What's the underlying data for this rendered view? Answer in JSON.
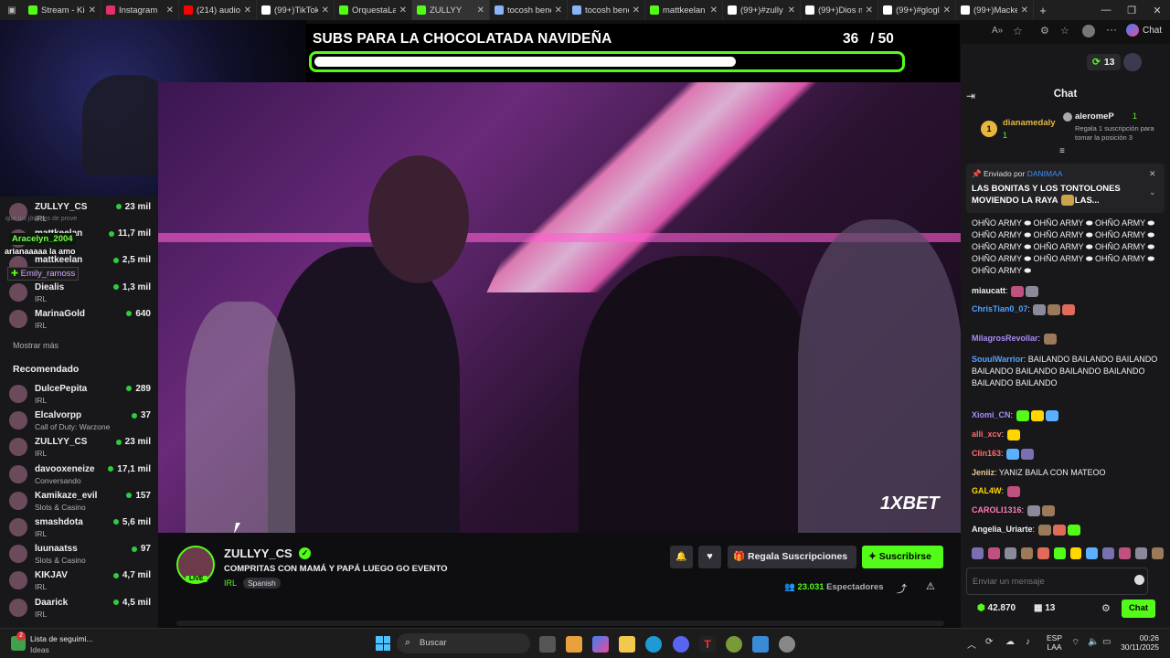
{
  "browser": {
    "tabs": [
      {
        "label": "Stream - Kic",
        "icon": "kick-icon",
        "color": "#53fc18"
      },
      {
        "label": "Instagram",
        "icon": "instagram-icon",
        "color": "#e1306c"
      },
      {
        "label": "(214) audio",
        "icon": "youtube-icon",
        "color": "#ff0000"
      },
      {
        "label": "(99+)TikTok",
        "icon": "tiktok-icon",
        "color": "#ffffff"
      },
      {
        "label": "OrquestaLal",
        "icon": "kick-icon",
        "color": "#53fc18"
      },
      {
        "label": "ZULLYY",
        "icon": "kick-icon",
        "color": "#53fc18"
      },
      {
        "label": "tocosh bene",
        "icon": "search-icon",
        "color": "#8ab4f8"
      },
      {
        "label": "tocosh bene",
        "icon": "search-icon",
        "color": "#8ab4f8"
      },
      {
        "label": "mattkeelan",
        "icon": "kick-icon",
        "color": "#53fc18"
      },
      {
        "label": "(99+)#zully",
        "icon": "tiktok-icon",
        "color": "#ffffff"
      },
      {
        "label": "(99+)Dios m",
        "icon": "tiktok-icon",
        "color": "#ffffff"
      },
      {
        "label": "(99+)#glogl",
        "icon": "tiktok-icon",
        "color": "#ffffff"
      },
      {
        "label": "(99+)Macke",
        "icon": "tiktok-icon",
        "color": "#ffffff"
      }
    ],
    "chat_button": "Chat"
  },
  "overlay": {
    "goal_title": "SUBS PARA LA CHOCOLATADA NAVIDEÑA",
    "goal_current": "36",
    "goal_total": "/ 50",
    "goal_progress": 0.72,
    "sponsor": "1XBET"
  },
  "viewer_overlay": {
    "names": [
      "Aracelyn_2004",
      "arianaaaaa la amo",
      "Emily_ramoss"
    ],
    "ghost_text": "que tus jóvenes de prove"
  },
  "sidebar": {
    "following": [
      {
        "name": "ZULLYY_CS",
        "category": "IRL",
        "viewers": "23 mil"
      },
      {
        "name": "mattkeelan",
        "category": "",
        "viewers": "11,7 mil"
      },
      {
        "name": "mattkeelan",
        "category": "",
        "viewers": "2,5 mil"
      },
      {
        "name": "Diealis",
        "category": "IRL",
        "viewers": "1,3 mil"
      },
      {
        "name": "MarinaGold",
        "category": "IRL",
        "viewers": "640"
      }
    ],
    "show_more": "Mostrar más",
    "recommended_title": "Recomendado",
    "recommended": [
      {
        "name": "DulcePepita",
        "category": "IRL",
        "viewers": "289"
      },
      {
        "name": "Elcalvorpp",
        "category": "Call of Duty: Warzone",
        "viewers": "37"
      },
      {
        "name": "ZULLYY_CS",
        "category": "IRL",
        "viewers": "23 mil"
      },
      {
        "name": "davooxeneize",
        "category": "Conversando",
        "viewers": "17,1 mil"
      },
      {
        "name": "Kamikaze_evil",
        "category": "Slots & Casino",
        "viewers": "157"
      },
      {
        "name": "smashdota",
        "category": "IRL",
        "viewers": "5,6 mil"
      },
      {
        "name": "luunaatss",
        "category": "Slots & Casino",
        "viewers": "97"
      },
      {
        "name": "KIKJAV",
        "category": "IRL",
        "viewers": "4,7 mil"
      },
      {
        "name": "Daarick",
        "category": "IRL",
        "viewers": "4,5 mil"
      }
    ]
  },
  "stream": {
    "name": "ZULLYY_CS",
    "title": "COMPRITAS CON MAMÁ Y PAPÁ LUEGO GO EVENTO",
    "category": "IRL",
    "tag": "Spanish",
    "live": "LIVE",
    "viewers": "23.031",
    "viewers_label": "Espectadores",
    "gift_button": "Regala Suscripciones",
    "subscribe_button": "Suscribirse"
  },
  "chat": {
    "title": "Chat",
    "top_count": "13",
    "leaders": [
      {
        "rank": "1",
        "name": "dianamedaly",
        "value": "1"
      },
      {
        "name": "aleromeP",
        "value": "1",
        "note": "Regala 1 suscripción para tomar la posición 3"
      }
    ],
    "pinned_by_label": "Enviado por",
    "pinned_by": "DANIMAA",
    "pinned_text": "LAS BONITAS Y LOS TONTOLONES MOVIENDO LA RAYA",
    "pinned_tail": "LAS...",
    "messages": [
      {
        "user": "",
        "text": "OHÑO ARMY ⬬ OHÑO ARMY ⬬ OHÑO ARMY ⬬ OHÑO ARMY ⬬ OHÑO ARMY ⬬ OHÑO ARMY ⬬ OHÑO ARMY ⬬ OHÑO ARMY ⬬ OHÑO ARMY ⬬ OHÑO ARMY ⬬ OHÑO ARMY ⬬ OHÑO ARMY ⬬ OHÑO ARMY ⬬",
        "color": "#efeff1"
      },
      {
        "user": "miaucatt",
        "text": "",
        "color": "#efeff1"
      },
      {
        "user": "ChrisTian0_07",
        "text": "",
        "color": "#4fa3ff"
      },
      {
        "user": "MilagrosRevollar",
        "text": "",
        "color": "#a78bfa"
      },
      {
        "user": "SouulWarrior",
        "text": "BAILANDO BAILANDO BAILANDO BAILANDO BAILANDO BAILANDO BAILANDO BAILANDO BAILANDO",
        "color": "#4fa3ff"
      },
      {
        "user": "Xiomi_CN",
        "text": "",
        "color": "#a78bfa"
      },
      {
        "user": "alli_xcv",
        "text": "",
        "color": "#ff6b6b"
      },
      {
        "user": "Clin163",
        "text": "",
        "color": "#ff6b6b"
      },
      {
        "user": "Jeniiz",
        "text": "YANIZ BAILA CON MATEOO",
        "color": "#e8c98a"
      },
      {
        "user": "GAL4W",
        "text": "",
        "color": "#ffd600"
      },
      {
        "user": "CAROLI1316",
        "text": "",
        "color": "#ff7ab8"
      },
      {
        "user": "Angelia_Uriarte",
        "text": "",
        "color": "#efeff1"
      }
    ],
    "input_placeholder": "Enviar un mensaje",
    "points": "42.870",
    "gifts": "13",
    "send_button": "Chat"
  },
  "taskbar": {
    "widget_title": "Lista de seguimi...",
    "widget_sub": "Ideas",
    "widget_badge": "2",
    "search": "Buscar",
    "lang": "ESP",
    "lang_sub": "LAA",
    "time": "00:26",
    "date": "30/11/2025"
  }
}
